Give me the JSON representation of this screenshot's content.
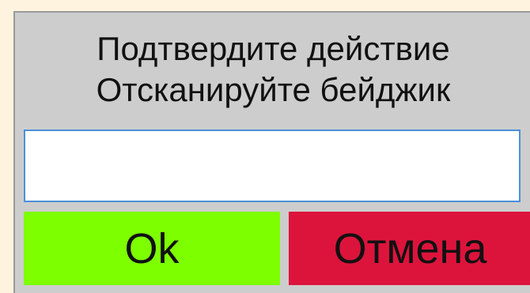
{
  "dialog": {
    "message_line1": "Подтвердите действие",
    "message_line2": "Отсканируйте бейджик",
    "input_value": "",
    "ok_label": "Ok",
    "cancel_label": "Отмена"
  },
  "colors": {
    "page_background": "#fdf3df",
    "dialog_background": "#cdcdcd",
    "ok_button": "#7dff00",
    "cancel_button": "#dc143c",
    "input_border": "#4a90d9"
  }
}
